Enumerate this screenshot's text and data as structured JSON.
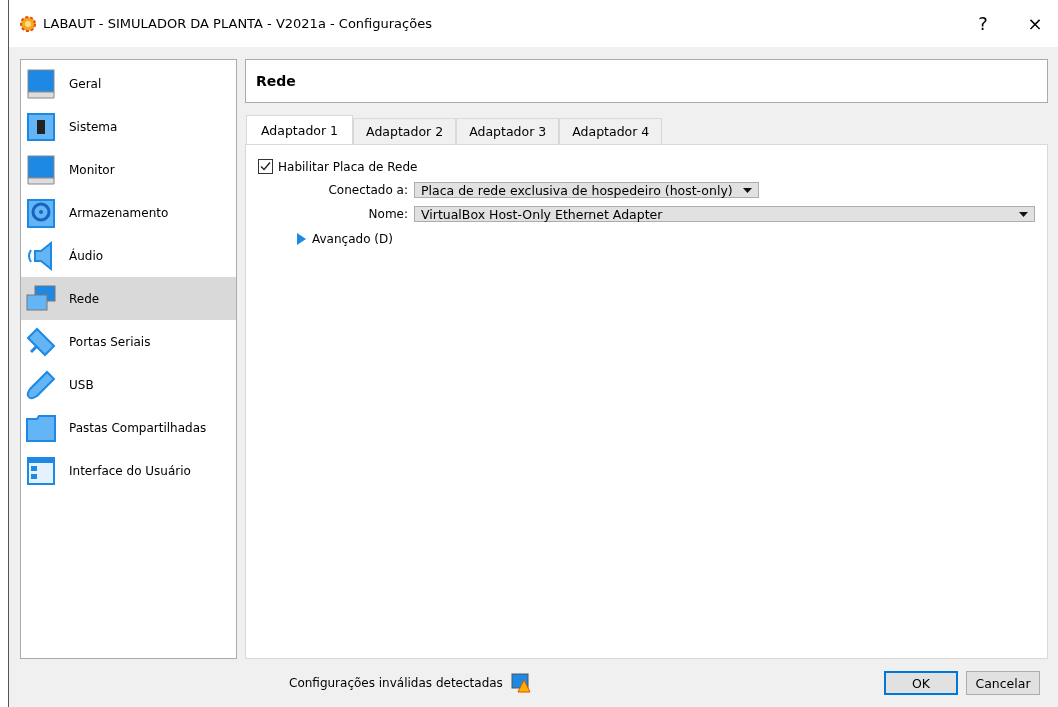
{
  "window": {
    "title": "LABAUT - SIMULADOR DA PLANTA - V2021a - Configurações",
    "help": "?",
    "close": "×"
  },
  "sidebar": {
    "items": [
      {
        "label": "Geral",
        "selected": false
      },
      {
        "label": "Sistema",
        "selected": false
      },
      {
        "label": "Monitor",
        "selected": false
      },
      {
        "label": "Armazenamento",
        "selected": false
      },
      {
        "label": "Áudio",
        "selected": false
      },
      {
        "label": "Rede",
        "selected": true
      },
      {
        "label": "Portas Seriais",
        "selected": false
      },
      {
        "label": "USB",
        "selected": false
      },
      {
        "label": "Pastas Compartilhadas",
        "selected": false
      },
      {
        "label": "Interface do Usuário",
        "selected": false
      }
    ]
  },
  "page": {
    "title": "Rede",
    "tabs": [
      {
        "label": "Adaptador 1",
        "selected": true
      },
      {
        "label": "Adaptador 2",
        "selected": false
      },
      {
        "label": "Adaptador 3",
        "selected": false
      },
      {
        "label": "Adaptador 4",
        "selected": false
      }
    ],
    "enable": {
      "label": "Habilitar Placa de Rede",
      "checked": true
    },
    "fields": [
      {
        "label": "Conectado a:",
        "value": "Placa de rede exclusiva de hospedeiro (host-only)",
        "wide": false
      },
      {
        "label": "Nome:",
        "value": "VirtualBox Host-Only Ethernet Adapter",
        "wide": true
      }
    ],
    "advanced": {
      "label": "Avançado (D)",
      "expanded": false
    }
  },
  "footer": {
    "status": "Configurações inválidas detectadas",
    "buttons": [
      {
        "label": "OK",
        "default": true
      },
      {
        "label": "Cancelar",
        "default": false
      }
    ]
  }
}
